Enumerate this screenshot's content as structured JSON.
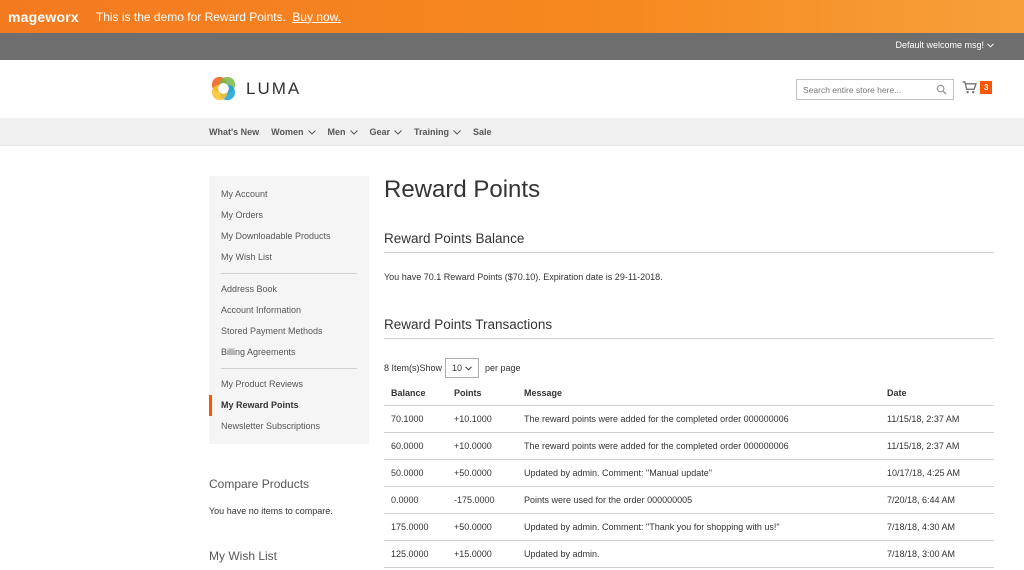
{
  "demo_bar": {
    "brand": "mageworx",
    "message": "This is the demo for Reward Points.",
    "link": "Buy now."
  },
  "topbar": {
    "welcome": "Default welcome msg!"
  },
  "header": {
    "logo_text": "LUMA",
    "search_placeholder": "Search entire store here...",
    "cart_count": "3"
  },
  "nav": {
    "items": [
      {
        "label": "What's New"
      },
      {
        "label": "Women"
      },
      {
        "label": "Men"
      },
      {
        "label": "Gear"
      },
      {
        "label": "Training"
      },
      {
        "label": "Sale"
      }
    ]
  },
  "sidebar": {
    "group1": [
      "My Account",
      "My Orders",
      "My Downloadable Products",
      "My Wish List"
    ],
    "group2": [
      "Address Book",
      "Account Information",
      "Stored Payment Methods",
      "Billing Agreements"
    ],
    "group3": [
      "My Product Reviews",
      "My Reward Points",
      "Newsletter Subscriptions"
    ]
  },
  "compare": {
    "title": "Compare Products",
    "empty": "You have no items to compare."
  },
  "wishlist": {
    "title": "My Wish List"
  },
  "main": {
    "title": "Reward Points",
    "balance_title": "Reward Points Balance",
    "balance_text": "You have 70.1 Reward Points ($70.10). Expiration date is 29-11-2018.",
    "transactions_title": "Reward Points Transactions",
    "items_count": "8 Item(s)",
    "show_label": "Show",
    "limit_value": "10",
    "per_page": "per page",
    "columns": [
      "Balance",
      "Points",
      "Message",
      "Date"
    ],
    "rows": [
      [
        "70.1000",
        "+10.1000",
        "The reward points were added for the completed order 000000006",
        "11/15/18, 2:37 AM"
      ],
      [
        "60.0000",
        "+10.0000",
        "The reward points were added for the completed order 000000006",
        "11/15/18, 2:37 AM"
      ],
      [
        "50.0000",
        "+50.0000",
        "Updated by admin. Comment: \"Manual update\"",
        "10/17/18, 4:25 AM"
      ],
      [
        "0.0000",
        "-175.0000",
        "Points were used for the order 000000005",
        "7/20/18, 6:44 AM"
      ],
      [
        "175.0000",
        "+50.0000",
        "Updated by admin. Comment: \"Thank you for shopping with us!\"",
        "7/18/18, 4:30 AM"
      ],
      [
        "125.0000",
        "+15.0000",
        "Updated by admin.",
        "7/18/18, 3:00 AM"
      ]
    ]
  }
}
